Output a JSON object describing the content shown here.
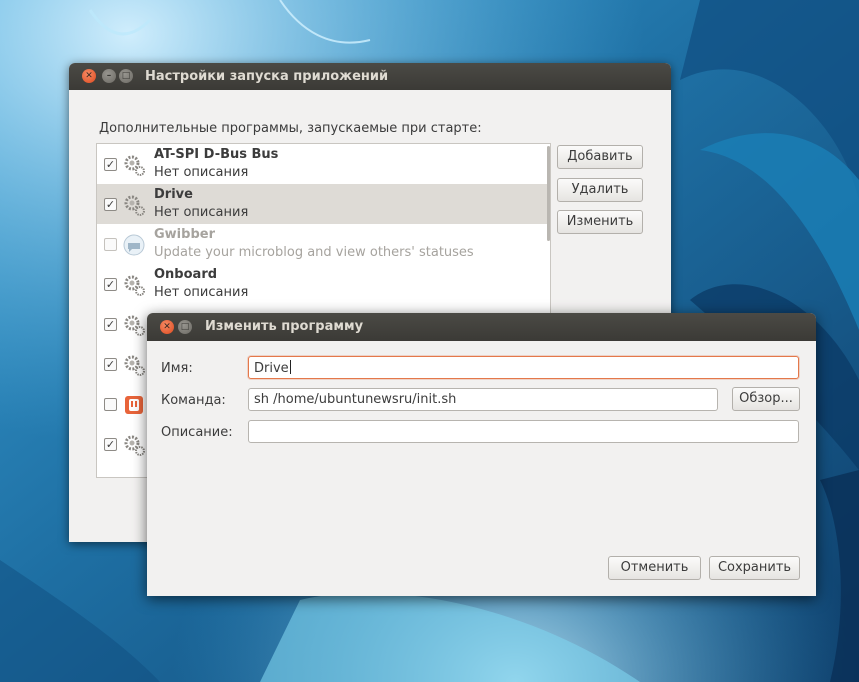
{
  "main_window": {
    "title": "Настройки запуска приложений",
    "list_label": "Дополнительные программы, запускаемые при старте:",
    "buttons": {
      "add": "Добавить",
      "remove": "Удалить",
      "edit": "Изменить"
    },
    "items": [
      {
        "name": "AT-SPI D-Bus Bus",
        "description": "Нет описания",
        "checked": true,
        "icon": "gear-icon"
      },
      {
        "name": "Drive",
        "description": "Нет описания",
        "checked": true,
        "icon": "gear-icon",
        "selected": true
      },
      {
        "name": "Gwibber",
        "description": "Update your microblog and view others' statuses",
        "checked": false,
        "icon": "gwibber-icon",
        "disabled": true
      },
      {
        "name": "Onboard",
        "description": "Нет описания",
        "checked": true,
        "icon": "gear-icon"
      },
      {
        "name": "",
        "description": "",
        "checked": true,
        "icon": "gear-icon"
      },
      {
        "name": "",
        "description": "",
        "checked": true,
        "icon": "gear-icon"
      },
      {
        "name": "",
        "description": "",
        "checked": false,
        "icon": "ubuntu-one-icon"
      },
      {
        "name": "",
        "description": "",
        "checked": true,
        "icon": "gear-icon"
      }
    ]
  },
  "dialog": {
    "title": "Изменить программу",
    "name_label": "Имя:",
    "name_value": "Drive",
    "command_label": "Команда:",
    "command_value": "sh /home/ubuntunewsru/init.sh",
    "browse_button": "Обзор...",
    "description_label": "Описание:",
    "description_value": "",
    "cancel_button": "Отменить",
    "save_button": "Сохранить"
  },
  "colors": {
    "titlebar": "#3b3a36",
    "window_bg": "#f2f1f0",
    "close_button": "#dd4a1f",
    "focus_border": "#e4784a",
    "selected_row": "#dedbd6"
  }
}
